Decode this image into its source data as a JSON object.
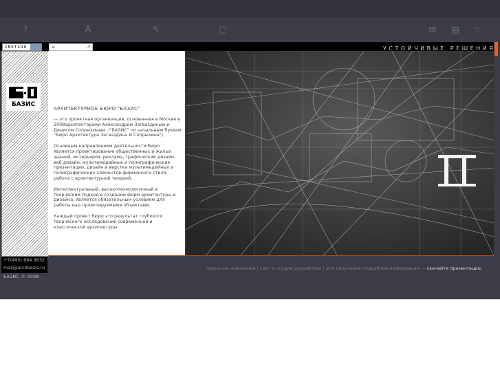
{
  "header": {
    "tagline": "УСТОЙЧИВЫЕ РЕШЕНИЯ",
    "inetlog_label": "INETLOG",
    "search_value": "≡",
    "search_go": "↗",
    "icons": [
      "info-icon",
      "font-icon",
      "pencil-icon",
      "book-icon",
      "mail-icon",
      "document-icon",
      "star-icon"
    ]
  },
  "logo": {
    "text": "БАЗИС"
  },
  "content": {
    "title": "АРХИТЕКТУРНОЕ БЮРО \"БАЗИС\"",
    "paragraphs": [
      "— это проектная организация, основанная в Москве в    2008архитекторами Александром Загвазди­ным и Денисом Спорыхиным. (\"БАЗИС\" по начальным буквам \"Бюро Архитектура Загвазди­на И Спорыхина\")",
      "Основным направлением деятельности бюро является проектирование общественных и жилых зданий, интерьеров, реклама, графический дизайн, веб дизайн, мультимедийные и полиграфические презентации, дизайн и верстка мультимедийных и полиграфических элементов фирменного стиля, работа с архитектурной теорией.",
      "Интеллектуальный, высокотехнологичный и творческий подход в создании форм архитектуры и дизайна, является обязательным условием для работы над проектируемыми объектами.",
      "Каждый проект бюро это результат глубокого творческого исследования современной и классической архитектуры."
    ]
  },
  "contacts": {
    "phone": "+7(495) 694 3632",
    "email": "mail@archbazis.ru"
  },
  "footer": {
    "copyright": "БАЗИС © 2008",
    "note": "приносим извинения | сайт в стадии разработки | для получения подробной информации — ",
    "link": "скачайте презентацию"
  },
  "colors": {
    "accent": "#e8620f",
    "background": "#3b3c48"
  }
}
